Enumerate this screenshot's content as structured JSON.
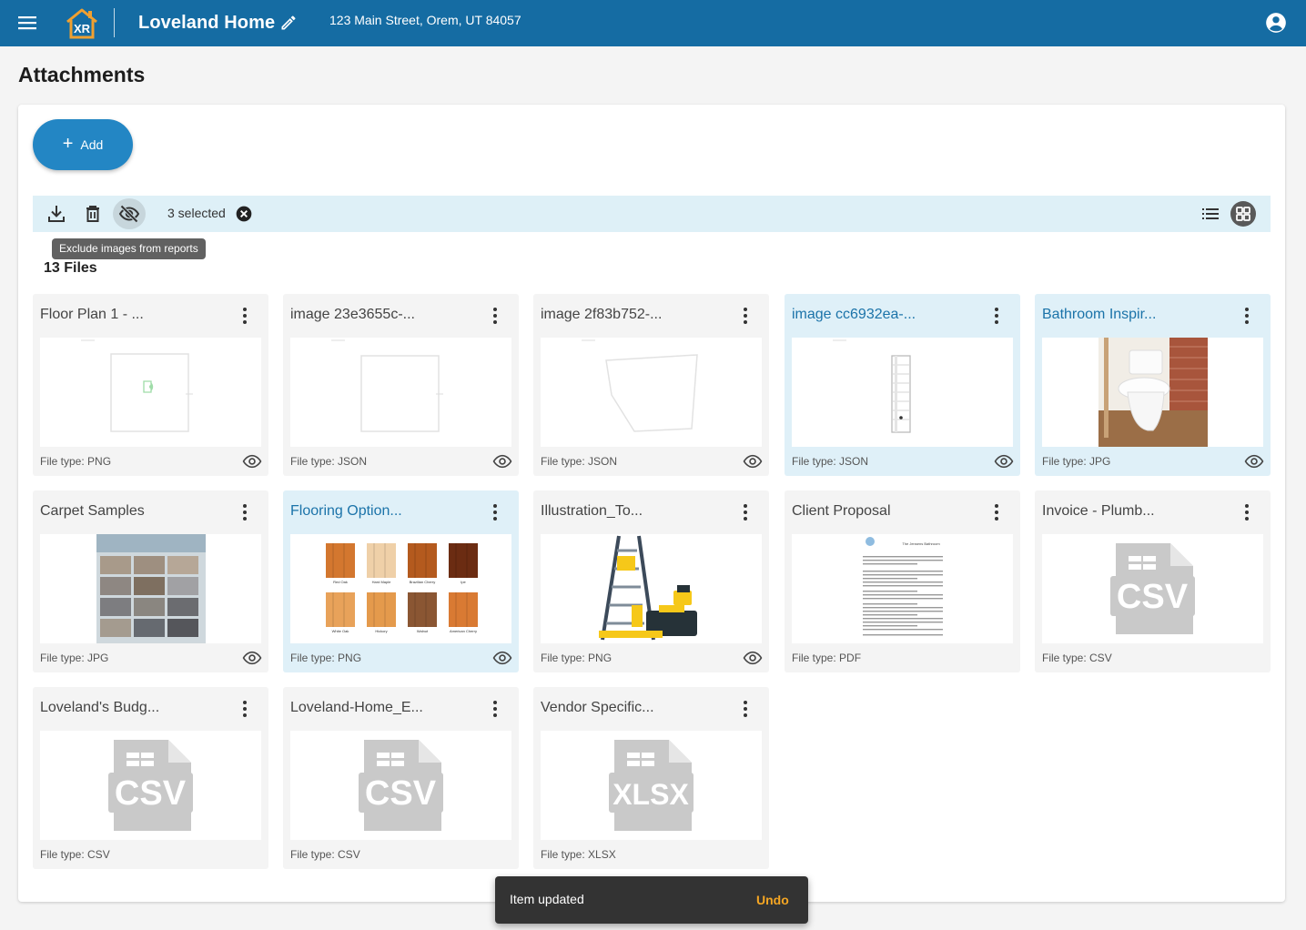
{
  "app": {
    "project_name": "Loveland Home",
    "address": "123 Main Street, Orem, UT 84057",
    "logo_text": "XR",
    "brand_color": "#156ca3",
    "accent_color": "#2386c4"
  },
  "page": {
    "title": "Attachments"
  },
  "toolbar": {
    "add_label": "Add",
    "selection_text": "3 selected",
    "tooltip": "Exclude images from reports",
    "icons": [
      "download-icon",
      "delete-icon",
      "eye-off-icon",
      "clear-selection-icon",
      "list-view-icon",
      "grid-view-icon"
    ]
  },
  "files": {
    "count_label": "13 Files",
    "items": [
      {
        "name": "Floor Plan 1 - ...",
        "type": "File type: PNG",
        "thumb": "floorplan",
        "selected": false,
        "eye": true
      },
      {
        "name": "image 23e3655c-...",
        "type": "File type: JSON",
        "thumb": "room-square",
        "selected": false,
        "eye": true
      },
      {
        "name": "image 2f83b752-...",
        "type": "File type: JSON",
        "thumb": "room-poly",
        "selected": false,
        "eye": true
      },
      {
        "name": "image cc6932ea-...",
        "type": "File type: JSON",
        "thumb": "room-narrow",
        "selected": true,
        "eye": true
      },
      {
        "name": "Bathroom Inspir...",
        "type": "File type: JPG",
        "thumb": "toilet-photo",
        "selected": true,
        "eye": true
      },
      {
        "name": "Carpet Samples",
        "type": "File type: JPG",
        "thumb": "carpet-photo",
        "selected": false,
        "eye": true
      },
      {
        "name": "Flooring Option...",
        "type": "File type: PNG",
        "thumb": "wood-samples",
        "selected": true,
        "eye": true
      },
      {
        "name": "Illustration_To...",
        "type": "File type: PNG",
        "thumb": "tools-illustration",
        "selected": false,
        "eye": true
      },
      {
        "name": "Client Proposal",
        "type": "File type: PDF",
        "thumb": "document",
        "selected": false,
        "eye": false
      },
      {
        "name": "Invoice - Plumb...",
        "type": "File type: CSV",
        "thumb": "csv",
        "selected": false,
        "eye": false
      },
      {
        "name": "Loveland's Budg...",
        "type": "File type: CSV",
        "thumb": "csv",
        "selected": false,
        "eye": false
      },
      {
        "name": "Loveland-Home_E...",
        "type": "File type: CSV",
        "thumb": "csv",
        "selected": false,
        "eye": false
      },
      {
        "name": "Vendor Specific...",
        "type": "File type: XLSX",
        "thumb": "xlsx",
        "selected": false,
        "eye": false
      }
    ]
  },
  "wood_samples": [
    "Red Oak",
    "Hard Maple",
    "Brazilian Cherry",
    "Ipe",
    "White Oak",
    "Hickory",
    "Walnut",
    "American Cherry"
  ],
  "file_icon_labels": {
    "csv": "CSV",
    "xlsx": "XLSX"
  },
  "proposal_doc_title": "The Jensens Bathroom",
  "snackbar": {
    "message": "Item updated",
    "action": "Undo"
  }
}
